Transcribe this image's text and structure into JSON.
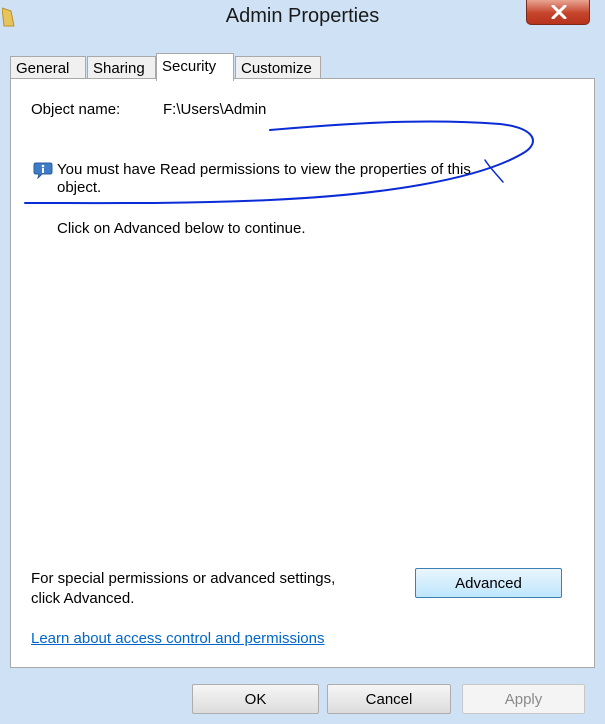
{
  "window": {
    "title": "Admin Properties",
    "close_icon": "close-icon",
    "folder_icon": "folder-icon"
  },
  "tabs": [
    {
      "label": "General"
    },
    {
      "label": "Sharing"
    },
    {
      "label": "Security",
      "active": true
    },
    {
      "label": "Customize"
    }
  ],
  "security": {
    "object_name_label": "Object name:",
    "object_name_value": "F:\\Users\\Admin",
    "info_line1": "You must have Read permissions to view the properties of this",
    "info_line2": "object.",
    "continue_text": "Click on Advanced below to continue.",
    "special_line1": "For special permissions or advanced settings,",
    "special_line2": "click Advanced.",
    "advanced_button": "Advanced",
    "learn_link": "Learn about access control and permissions"
  },
  "footer": {
    "ok": "OK",
    "cancel": "Cancel",
    "apply": "Apply"
  },
  "colors": {
    "title_bar": "#cfe2f5",
    "close_red": "#c4442b",
    "link_blue": "#0066cc",
    "annotation_ink": "#0a2bd6"
  }
}
